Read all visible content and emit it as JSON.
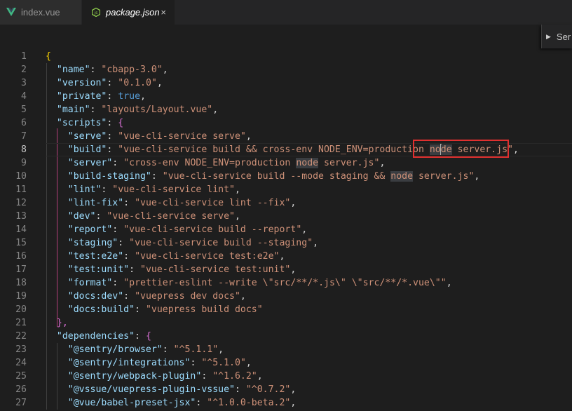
{
  "tabs": [
    {
      "label": "index.vue",
      "icon": "vue-icon",
      "active": false
    },
    {
      "label": "package.json",
      "icon": "nodejs-icon",
      "active": true,
      "close": "×"
    }
  ],
  "outline_widget": {
    "label": "Ser",
    "icon": "chevron-right-icon"
  },
  "editor": {
    "current_line": 8,
    "lines": [
      {
        "n": "1",
        "open": "{"
      },
      {
        "n": "2",
        "key": "\"name\"",
        "val": "\"cbapp-3.0\""
      },
      {
        "n": "3",
        "key": "\"version\"",
        "val": "\"0.1.0\""
      },
      {
        "n": "4",
        "key": "\"private\"",
        "val": "true"
      },
      {
        "n": "5",
        "key": "\"main\"",
        "val": "\"layouts/Layout.vue\""
      },
      {
        "n": "6",
        "key": "\"scripts\"",
        "open": "{"
      },
      {
        "n": "7",
        "key": "\"serve\"",
        "val": "\"vue-cli-service serve\""
      },
      {
        "n": "8",
        "key": "\"build\"",
        "val_a": "\"vue-cli-service build && cross-env NODE_ENV=production ",
        "val_b": "no",
        "val_c": "de",
        "val_d": " server.js\""
      },
      {
        "n": "9",
        "key": "\"server\"",
        "val_a": "\"cross-env NODE_ENV=production ",
        "val_hl": "node",
        "val_d": " server.js\""
      },
      {
        "n": "10",
        "key": "\"build-staging\"",
        "val_a": "\"vue-cli-service build --mode staging && ",
        "val_hl": "node",
        "val_d": " server.js\""
      },
      {
        "n": "11",
        "key": "\"lint\"",
        "val": "\"vue-cli-service lint\""
      },
      {
        "n": "12",
        "key": "\"lint-fix\"",
        "val": "\"vue-cli-service lint --fix\""
      },
      {
        "n": "13",
        "key": "\"dev\"",
        "val": "\"vue-cli-service serve\""
      },
      {
        "n": "14",
        "key": "\"report\"",
        "val": "\"vue-cli-service build --report\""
      },
      {
        "n": "15",
        "key": "\"staging\"",
        "val": "\"vue-cli-service build --staging\""
      },
      {
        "n": "16",
        "key": "\"test:e2e\"",
        "val": "\"vue-cli-service test:e2e\""
      },
      {
        "n": "17",
        "key": "\"test:unit\"",
        "val": "\"vue-cli-service test:unit\""
      },
      {
        "n": "18",
        "key": "\"format\"",
        "val": "\"prettier-eslint --write \\\"src/**/*.js\\\" \\\"src/**/*.vue\\\"\""
      },
      {
        "n": "19",
        "key": "\"docs:dev\"",
        "val": "\"vuepress dev docs\""
      },
      {
        "n": "20",
        "key": "\"docs:build\"",
        "val": "\"vuepress build docs\"",
        "last": true
      },
      {
        "n": "21",
        "close": "},"
      },
      {
        "n": "22",
        "key": "\"dependencies\"",
        "open": "{"
      },
      {
        "n": "23",
        "key": "\"@sentry/browser\"",
        "val": "\"^5.1.1\""
      },
      {
        "n": "24",
        "key": "\"@sentry/integrations\"",
        "val": "\"^5.1.0\""
      },
      {
        "n": "25",
        "key": "\"@sentry/webpack-plugin\"",
        "val": "\"^1.6.2\""
      },
      {
        "n": "26",
        "key": "\"@vssue/vuepress-plugin-vssue\"",
        "val": "\"^0.7.2\""
      },
      {
        "n": "27",
        "key": "\"@vue/babel-preset-jsx\"",
        "val": "\"^1.0.0-beta.2\""
      }
    ]
  },
  "colors": {
    "key": "#9cdcfe",
    "string": "#ce9178",
    "boolean": "#569cd6",
    "highlight_box": "#e0302f"
  }
}
